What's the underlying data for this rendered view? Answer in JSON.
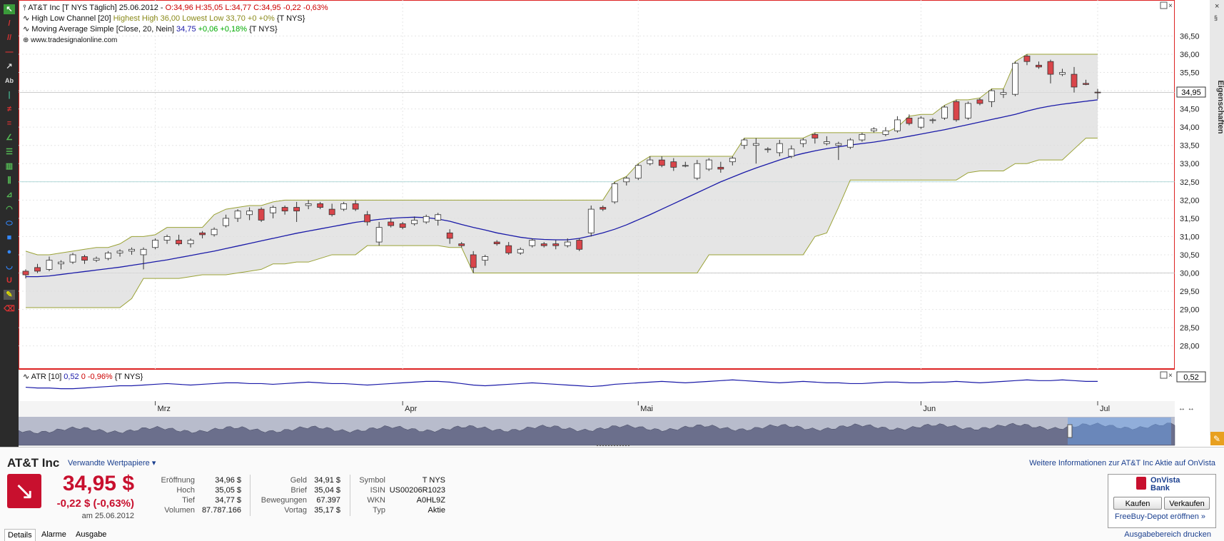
{
  "legend": {
    "main": {
      "instrument": "AT&T Inc [T NYS  Täglich] 25.06.2012 -",
      "ohlc": "O:34,96 H:35,05 L:34,77 C:34,95 -0,22 -0,63%"
    },
    "hlc": {
      "name": "High Low Channel [20]",
      "values": "Highest High 36,00 Lowest Low 33,70 +0 +0%",
      "exchange": "{T NYS}"
    },
    "ma": {
      "name": "Moving Average Simple [Close, 20, Nein]",
      "value": "34,75",
      "change": "+0,06 +0,18%",
      "exchange": "{T NYS}"
    },
    "website": "www.tradesignalonline.com"
  },
  "atr": {
    "name": "ATR [10]",
    "value": "0,52",
    "change": "0 -0,96%",
    "exchange": "{T NYS}",
    "badge": "0,52"
  },
  "price_badge": "34,95",
  "side_panel_label": "Eigenschaften",
  "bottom": {
    "name": "AT&T Inc",
    "related": "Verwandte Wertpapiere",
    "price": "34,95 $",
    "change": "-0,22 $ (-0,63%)",
    "date": "am 25.06.2012",
    "stats1": [
      {
        "label": "Eröffnung",
        "value": "34,96 $"
      },
      {
        "label": "Hoch",
        "value": "35,05 $"
      },
      {
        "label": "Tief",
        "value": "34,77 $"
      },
      {
        "label": "Volumen",
        "value": "87.787.166"
      }
    ],
    "stats2": [
      {
        "label": "Geld",
        "value": "34,91 $"
      },
      {
        "label": "Brief",
        "value": "35,04 $"
      },
      {
        "label": "Bewegungen",
        "value": "67.397"
      },
      {
        "label": "Vortag",
        "value": "35,17 $"
      }
    ],
    "stats3": [
      {
        "label": "Symbol",
        "value": "T NYS"
      },
      {
        "label": "ISIN",
        "value": "US00206R1023"
      },
      {
        "label": "WKN",
        "value": "A0HL9Z"
      },
      {
        "label": "Typ",
        "value": "Aktie"
      }
    ],
    "info_link": "Weitere Informationen zur AT&T Inc Aktie auf OnVista",
    "bank_name_1": "OnVista",
    "bank_name_2": "Bank",
    "buy": "Kaufen",
    "sell": "Verkaufen",
    "depot_link": "FreeBuy-Depot eröffnen »",
    "tabs": [
      "Details",
      "Alarme",
      "Ausgabe"
    ],
    "print_link": "Ausgabebereich drucken"
  },
  "chart_data": {
    "type": "candlestick",
    "title": "AT&T Inc [T NYS  Täglich]",
    "y_ticks": [
      "36,50",
      "36,00",
      "35,50",
      "35,00",
      "34,50",
      "34,00",
      "33,50",
      "33,00",
      "32,50",
      "32,00",
      "31,50",
      "31,00",
      "30,50",
      "30,00",
      "29,50",
      "29,00",
      "28,50",
      "28,00"
    ],
    "ylim": [
      27.7,
      36.9
    ],
    "x_labels": [
      "Mrz",
      "Apr",
      "Mai",
      "Jun",
      "Jul"
    ],
    "candles": [
      {
        "o": 30.05,
        "h": 30.1,
        "l": 29.85,
        "c": 29.95
      },
      {
        "o": 30.15,
        "h": 30.25,
        "l": 30.0,
        "c": 30.05
      },
      {
        "o": 30.1,
        "h": 30.45,
        "l": 30.05,
        "c": 30.35
      },
      {
        "o": 30.25,
        "h": 30.35,
        "l": 30.1,
        "c": 30.3
      },
      {
        "o": 30.3,
        "h": 30.55,
        "l": 30.25,
        "c": 30.5
      },
      {
        "o": 30.45,
        "h": 30.5,
        "l": 30.25,
        "c": 30.35
      },
      {
        "o": 30.35,
        "h": 30.45,
        "l": 30.3,
        "c": 30.4
      },
      {
        "o": 30.4,
        "h": 30.6,
        "l": 30.35,
        "c": 30.55
      },
      {
        "o": 30.55,
        "h": 30.65,
        "l": 30.45,
        "c": 30.6
      },
      {
        "o": 30.6,
        "h": 30.7,
        "l": 30.5,
        "c": 30.65
      },
      {
        "o": 30.5,
        "h": 30.7,
        "l": 30.1,
        "c": 30.65
      },
      {
        "o": 30.7,
        "h": 30.95,
        "l": 30.65,
        "c": 30.9
      },
      {
        "o": 30.9,
        "h": 31.05,
        "l": 30.8,
        "c": 31.0
      },
      {
        "o": 30.9,
        "h": 31.05,
        "l": 30.75,
        "c": 30.8
      },
      {
        "o": 30.8,
        "h": 30.95,
        "l": 30.7,
        "c": 30.9
      },
      {
        "o": 31.1,
        "h": 31.15,
        "l": 30.95,
        "c": 31.05
      },
      {
        "o": 31.05,
        "h": 31.25,
        "l": 31.0,
        "c": 31.2
      },
      {
        "o": 31.3,
        "h": 31.6,
        "l": 31.25,
        "c": 31.5
      },
      {
        "o": 31.5,
        "h": 31.75,
        "l": 31.4,
        "c": 31.7
      },
      {
        "o": 31.6,
        "h": 31.8,
        "l": 31.45,
        "c": 31.7
      },
      {
        "o": 31.75,
        "h": 31.8,
        "l": 31.4,
        "c": 31.45
      },
      {
        "o": 31.65,
        "h": 31.85,
        "l": 31.5,
        "c": 31.8
      },
      {
        "o": 31.8,
        "h": 31.85,
        "l": 31.6,
        "c": 31.7
      },
      {
        "o": 31.8,
        "h": 31.95,
        "l": 31.4,
        "c": 31.7
      },
      {
        "o": 31.85,
        "h": 32.0,
        "l": 31.75,
        "c": 31.9
      },
      {
        "o": 31.9,
        "h": 31.95,
        "l": 31.75,
        "c": 31.8
      },
      {
        "o": 31.75,
        "h": 31.9,
        "l": 31.55,
        "c": 31.6
      },
      {
        "o": 31.75,
        "h": 31.95,
        "l": 31.7,
        "c": 31.9
      },
      {
        "o": 31.9,
        "h": 32.0,
        "l": 31.7,
        "c": 31.75
      },
      {
        "o": 31.6,
        "h": 31.7,
        "l": 31.3,
        "c": 31.4
      },
      {
        "o": 30.85,
        "h": 31.4,
        "l": 30.75,
        "c": 31.25
      },
      {
        "o": 31.4,
        "h": 31.5,
        "l": 31.25,
        "c": 31.3
      },
      {
        "o": 31.35,
        "h": 31.4,
        "l": 31.2,
        "c": 31.25
      },
      {
        "o": 31.35,
        "h": 31.55,
        "l": 31.3,
        "c": 31.45
      },
      {
        "o": 31.4,
        "h": 31.6,
        "l": 31.35,
        "c": 31.55
      },
      {
        "o": 31.45,
        "h": 31.65,
        "l": 31.3,
        "c": 31.6
      },
      {
        "o": 31.1,
        "h": 31.2,
        "l": 30.8,
        "c": 30.95
      },
      {
        "o": 30.8,
        "h": 30.85,
        "l": 30.7,
        "c": 30.75
      },
      {
        "o": 30.5,
        "h": 30.6,
        "l": 30.0,
        "c": 30.15
      },
      {
        "o": 30.35,
        "h": 30.5,
        "l": 30.2,
        "c": 30.45
      },
      {
        "o": 30.85,
        "h": 30.9,
        "l": 30.75,
        "c": 30.8
      },
      {
        "o": 30.75,
        "h": 30.85,
        "l": 30.5,
        "c": 30.55
      },
      {
        "o": 30.55,
        "h": 30.7,
        "l": 30.5,
        "c": 30.65
      },
      {
        "o": 30.75,
        "h": 30.95,
        "l": 30.7,
        "c": 30.9
      },
      {
        "o": 30.8,
        "h": 30.85,
        "l": 30.7,
        "c": 30.75
      },
      {
        "o": 30.8,
        "h": 30.9,
        "l": 30.65,
        "c": 30.75
      },
      {
        "o": 30.75,
        "h": 30.95,
        "l": 30.7,
        "c": 30.85
      },
      {
        "o": 30.9,
        "h": 30.95,
        "l": 30.6,
        "c": 30.65
      },
      {
        "o": 31.1,
        "h": 31.85,
        "l": 31.0,
        "c": 31.75
      },
      {
        "o": 31.8,
        "h": 31.85,
        "l": 31.7,
        "c": 31.75
      },
      {
        "o": 31.95,
        "h": 32.5,
        "l": 31.9,
        "c": 32.45
      },
      {
        "o": 32.5,
        "h": 32.65,
        "l": 32.4,
        "c": 32.6
      },
      {
        "o": 32.6,
        "h": 33.0,
        "l": 32.55,
        "c": 32.95
      },
      {
        "o": 33.0,
        "h": 33.2,
        "l": 32.95,
        "c": 33.1
      },
      {
        "o": 33.1,
        "h": 33.2,
        "l": 32.9,
        "c": 32.95
      },
      {
        "o": 33.05,
        "h": 33.15,
        "l": 32.8,
        "c": 32.9
      },
      {
        "o": 32.95,
        "h": 33.05,
        "l": 32.9,
        "c": 32.95
      },
      {
        "o": 32.6,
        "h": 33.1,
        "l": 32.55,
        "c": 33.0
      },
      {
        "o": 32.85,
        "h": 33.15,
        "l": 32.8,
        "c": 33.1
      },
      {
        "o": 32.9,
        "h": 33.05,
        "l": 32.75,
        "c": 32.85
      },
      {
        "o": 33.05,
        "h": 33.2,
        "l": 32.95,
        "c": 33.15
      },
      {
        "o": 33.5,
        "h": 33.7,
        "l": 33.4,
        "c": 33.65
      },
      {
        "o": 33.5,
        "h": 33.7,
        "l": 33.0,
        "c": 33.55
      },
      {
        "o": 33.4,
        "h": 33.45,
        "l": 33.3,
        "c": 33.4
      },
      {
        "o": 33.3,
        "h": 33.65,
        "l": 33.2,
        "c": 33.55
      },
      {
        "o": 33.2,
        "h": 33.5,
        "l": 33.15,
        "c": 33.4
      },
      {
        "o": 33.55,
        "h": 33.7,
        "l": 33.45,
        "c": 33.65
      },
      {
        "o": 33.8,
        "h": 33.85,
        "l": 33.55,
        "c": 33.7
      },
      {
        "o": 33.55,
        "h": 33.75,
        "l": 33.5,
        "c": 33.6
      },
      {
        "o": 33.5,
        "h": 33.6,
        "l": 33.1,
        "c": 33.55
      },
      {
        "o": 33.45,
        "h": 33.7,
        "l": 33.4,
        "c": 33.65
      },
      {
        "o": 33.65,
        "h": 33.85,
        "l": 33.6,
        "c": 33.8
      },
      {
        "o": 33.9,
        "h": 34.0,
        "l": 33.85,
        "c": 33.95
      },
      {
        "o": 33.8,
        "h": 34.0,
        "l": 33.75,
        "c": 33.9
      },
      {
        "o": 33.9,
        "h": 34.3,
        "l": 33.85,
        "c": 34.2
      },
      {
        "o": 34.25,
        "h": 34.35,
        "l": 34.05,
        "c": 34.1
      },
      {
        "o": 34.0,
        "h": 34.3,
        "l": 33.95,
        "c": 34.25
      },
      {
        "o": 34.2,
        "h": 34.25,
        "l": 34.1,
        "c": 34.2
      },
      {
        "o": 34.25,
        "h": 34.6,
        "l": 34.2,
        "c": 34.55
      },
      {
        "o": 34.7,
        "h": 34.75,
        "l": 34.15,
        "c": 34.2
      },
      {
        "o": 34.25,
        "h": 34.7,
        "l": 34.2,
        "c": 34.65
      },
      {
        "o": 34.75,
        "h": 34.8,
        "l": 34.6,
        "c": 34.65
      },
      {
        "o": 34.7,
        "h": 35.05,
        "l": 34.55,
        "c": 35.0
      },
      {
        "o": 34.9,
        "h": 35.05,
        "l": 34.8,
        "c": 34.95
      },
      {
        "o": 34.9,
        "h": 35.8,
        "l": 34.85,
        "c": 35.75
      },
      {
        "o": 35.95,
        "h": 36.0,
        "l": 35.7,
        "c": 35.8
      },
      {
        "o": 35.7,
        "h": 35.8,
        "l": 35.6,
        "c": 35.65
      },
      {
        "o": 35.8,
        "h": 35.85,
        "l": 35.2,
        "c": 35.45
      },
      {
        "o": 35.45,
        "h": 35.6,
        "l": 35.4,
        "c": 35.5
      },
      {
        "o": 35.45,
        "h": 35.65,
        "l": 34.95,
        "c": 35.1
      },
      {
        "o": 35.2,
        "h": 35.3,
        "l": 35.15,
        "c": 35.17
      },
      {
        "o": 34.96,
        "h": 35.05,
        "l": 34.77,
        "c": 34.95
      }
    ],
    "channel_high": [
      30.6,
      30.5,
      30.5,
      30.55,
      30.6,
      30.65,
      30.7,
      30.7,
      30.8,
      31.0,
      31.0,
      31.05,
      31.25,
      31.25,
      31.25,
      31.25,
      31.6,
      31.75,
      31.8,
      31.85,
      31.85,
      31.95,
      32.0,
      32.0,
      32.0,
      32.0,
      32.0,
      32.0,
      32.0,
      32.0,
      32.0,
      32.0,
      32.0,
      32.0,
      32.0,
      32.0,
      32.0,
      32.0,
      32.0,
      32.0,
      32.0,
      32.0,
      32.0,
      32.0,
      32.0,
      32.0,
      32.0,
      32.0,
      32.0,
      32.0,
      32.5,
      32.65,
      33.0,
      33.2,
      33.2,
      33.2,
      33.2,
      33.2,
      33.2,
      33.2,
      33.2,
      33.7,
      33.7,
      33.7,
      33.7,
      33.7,
      33.7,
      33.85,
      33.85,
      33.85,
      33.85,
      33.85,
      33.85,
      33.85,
      34.0,
      34.3,
      34.35,
      34.35,
      34.6,
      34.75,
      34.75,
      34.8,
      35.05,
      35.05,
      35.8,
      36.0,
      36.0,
      36.0,
      36.0,
      36.0,
      36.0,
      36.0
    ],
    "channel_low": [
      29.05,
      29.05,
      29.05,
      29.05,
      29.05,
      29.05,
      29.05,
      29.05,
      29.05,
      29.3,
      29.85,
      29.85,
      29.85,
      29.85,
      29.9,
      29.95,
      29.95,
      29.95,
      30.0,
      30.05,
      30.1,
      30.25,
      30.25,
      30.3,
      30.3,
      30.4,
      30.5,
      30.5,
      30.5,
      30.75,
      30.75,
      30.75,
      30.75,
      30.75,
      30.75,
      30.75,
      30.7,
      30.7,
      30.0,
      30.0,
      30.0,
      30.0,
      30.0,
      30.0,
      30.0,
      30.0,
      30.0,
      30.0,
      30.0,
      30.0,
      30.0,
      30.0,
      30.0,
      30.0,
      30.0,
      30.0,
      30.0,
      30.0,
      30.5,
      30.5,
      30.5,
      30.5,
      30.5,
      30.5,
      30.5,
      30.5,
      30.5,
      31.0,
      31.1,
      31.8,
      32.55,
      32.55,
      32.55,
      32.55,
      32.55,
      32.55,
      32.55,
      32.55,
      32.55,
      32.55,
      32.75,
      32.8,
      32.8,
      32.8,
      33.0,
      33.0,
      33.1,
      33.1,
      33.1,
      33.4,
      33.7,
      33.7
    ],
    "moving_average": [
      29.9,
      29.9,
      29.92,
      29.96,
      30.0,
      30.04,
      30.08,
      30.12,
      30.16,
      30.21,
      30.26,
      30.31,
      30.36,
      30.42,
      30.48,
      30.54,
      30.6,
      30.67,
      30.74,
      30.81,
      30.88,
      30.95,
      31.02,
      31.09,
      31.15,
      31.21,
      31.27,
      31.33,
      31.39,
      31.43,
      31.47,
      31.5,
      31.52,
      31.53,
      31.52,
      31.48,
      31.42,
      31.33,
      31.25,
      31.18,
      31.1,
      31.04,
      30.98,
      30.94,
      30.92,
      30.91,
      30.91,
      30.95,
      31.02,
      31.1,
      31.2,
      31.32,
      31.46,
      31.6,
      31.75,
      31.9,
      32.05,
      32.2,
      32.35,
      32.5,
      32.63,
      32.76,
      32.88,
      32.99,
      33.1,
      33.2,
      33.28,
      33.35,
      33.41,
      33.46,
      33.51,
      33.55,
      33.59,
      33.64,
      33.69,
      33.75,
      33.81,
      33.87,
      33.93,
      34.0,
      34.07,
      34.14,
      34.21,
      34.28,
      34.35,
      34.44,
      34.52,
      34.58,
      34.63,
      34.67,
      34.71,
      34.75
    ],
    "atr_values": [
      0.45,
      0.44,
      0.44,
      0.43,
      0.43,
      0.44,
      0.45,
      0.46,
      0.47,
      0.47,
      0.48,
      0.49,
      0.5,
      0.49,
      0.48,
      0.49,
      0.5,
      0.51,
      0.51,
      0.5,
      0.5,
      0.49,
      0.5,
      0.51,
      0.52,
      0.51,
      0.5,
      0.5,
      0.49,
      0.48,
      0.49,
      0.5,
      0.51,
      0.52,
      0.53,
      0.53,
      0.52,
      0.5,
      0.48,
      0.47,
      0.48,
      0.49,
      0.5,
      0.51,
      0.5,
      0.49,
      0.48,
      0.47,
      0.46,
      0.47,
      0.49,
      0.5,
      0.51,
      0.52,
      0.53,
      0.52,
      0.51,
      0.52,
      0.53,
      0.54,
      0.55,
      0.54,
      0.53,
      0.52,
      0.51,
      0.52,
      0.53,
      0.52,
      0.51,
      0.51,
      0.5,
      0.5,
      0.51,
      0.52,
      0.52,
      0.51,
      0.51,
      0.52,
      0.52,
      0.53,
      0.52,
      0.51,
      0.52,
      0.53,
      0.54,
      0.55,
      0.54,
      0.54,
      0.55,
      0.54,
      0.53,
      0.53
    ],
    "atr_ylim": [
      0.3,
      0.65
    ]
  },
  "colors": {
    "up": "#ffffff",
    "down": "#d9454a",
    "channel": "#9aa236",
    "channel_fill": "#dcdcdc",
    "ma": "#1a1aa8",
    "accent_red": "#c8102e",
    "link_blue": "#1a3f8f"
  }
}
